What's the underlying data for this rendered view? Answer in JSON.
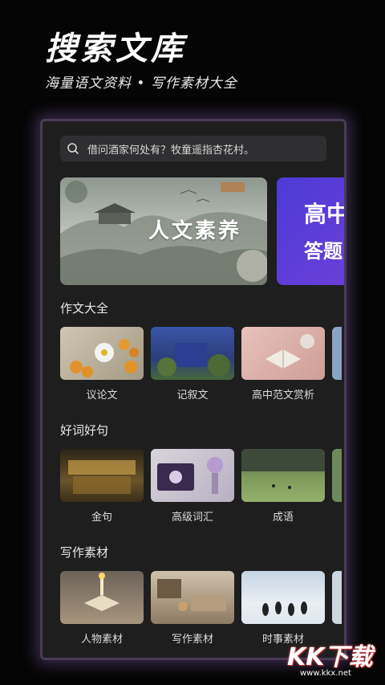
{
  "hero": {
    "title": "搜索文库",
    "subtitle": "海量语文资料  •  写作素材大全"
  },
  "search": {
    "icon": "search-icon",
    "placeholder": "借问酒家何处有？牧童遥指杏花村。"
  },
  "banners": [
    {
      "label": "人文素养"
    },
    {
      "line1": "高中",
      "line2": "答题"
    }
  ],
  "sections": [
    {
      "title": "作文大全",
      "items": [
        {
          "label": "议论文"
        },
        {
          "label": "记叙文"
        },
        {
          "label": "高中范文赏析"
        }
      ]
    },
    {
      "title": "好词好句",
      "items": [
        {
          "label": "金句"
        },
        {
          "label": "高级词汇"
        },
        {
          "label": "成语"
        }
      ]
    },
    {
      "title": "写作素材",
      "items": [
        {
          "label": "人物素材"
        },
        {
          "label": "写作素材"
        },
        {
          "label": "时事素材"
        }
      ]
    }
  ],
  "watermark": {
    "logo": "KK下载",
    "url": "www.kkx.net"
  },
  "colors": {
    "accent_purple": "#5a3fd8",
    "frame_glow": "#9a6ecf",
    "background": "#050505"
  }
}
